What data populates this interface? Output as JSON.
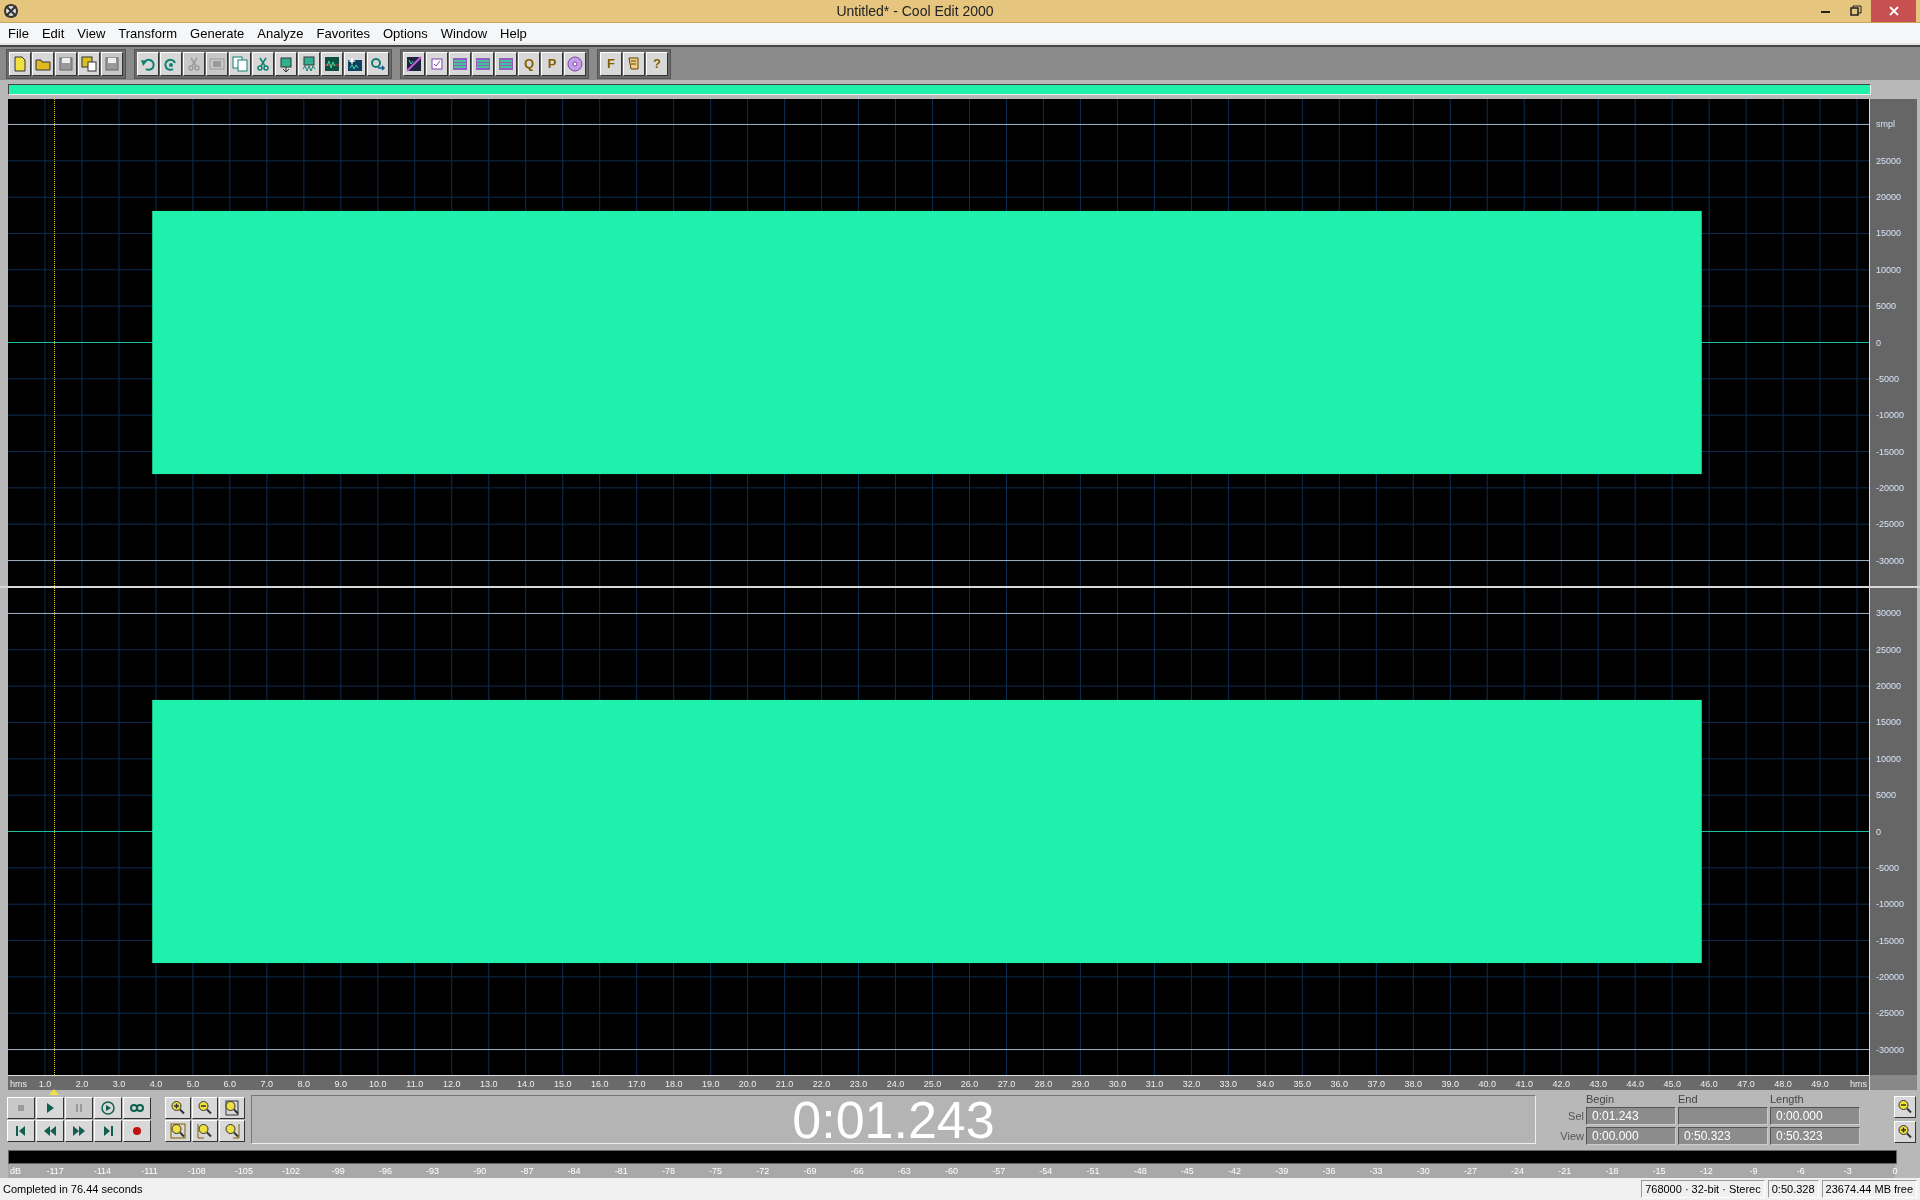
{
  "window": {
    "title": "Untitled* - Cool Edit 2000"
  },
  "menu": [
    "File",
    "Edit",
    "View",
    "Transform",
    "Generate",
    "Analyze",
    "Favorites",
    "Options",
    "Window",
    "Help"
  ],
  "toolbar_groups": [
    [
      {
        "kind": "new-file",
        "disabled": false
      },
      {
        "kind": "folder",
        "disabled": false
      },
      {
        "kind": "disk",
        "disabled": true
      },
      {
        "kind": "disk-copy",
        "disabled": false
      },
      {
        "kind": "disk",
        "disabled": true
      }
    ],
    [
      {
        "kind": "undo",
        "disabled": false
      },
      {
        "kind": "redo",
        "disabled": false
      },
      {
        "kind": "scissors",
        "disabled": true
      },
      {
        "kind": "frame",
        "disabled": true
      },
      {
        "kind": "copy",
        "disabled": false
      },
      {
        "kind": "scissors",
        "disabled": false
      },
      {
        "kind": "paste",
        "disabled": false
      },
      {
        "kind": "paste-wave",
        "disabled": false
      },
      {
        "kind": "wave-window",
        "disabled": false
      },
      {
        "kind": "spark-wave",
        "disabled": false
      },
      {
        "kind": "wave-arrow",
        "disabled": false
      }
    ],
    [
      {
        "kind": "spectral",
        "disabled": false
      },
      {
        "kind": "checkbox",
        "disabled": false
      },
      {
        "kind": "tracks",
        "disabled": false
      },
      {
        "kind": "tracks",
        "disabled": false
      },
      {
        "kind": "tracks",
        "disabled": false
      },
      {
        "kind": "glyph",
        "glyph": "Q",
        "disabled": false
      },
      {
        "kind": "glyph",
        "glyph": "P",
        "disabled": false
      },
      {
        "kind": "cd",
        "disabled": false
      }
    ],
    [
      {
        "kind": "glyph",
        "glyph": "F",
        "disabled": false
      },
      {
        "kind": "scroll",
        "disabled": false
      },
      {
        "kind": "glyph",
        "glyph": "?",
        "disabled": false
      }
    ]
  ],
  "channels": [
    {
      "axis_label": "smpl",
      "ticks": [
        "25000",
        "20000",
        "15000",
        "10000",
        "5000",
        "0",
        "-5000",
        "-10000",
        "-15000",
        "-20000",
        "-25000",
        "-30000"
      ]
    },
    {
      "ticks": [
        "30000",
        "25000",
        "20000",
        "15000",
        "10000",
        "5000",
        "0",
        "-5000",
        "-10000",
        "-15000",
        "-20000",
        "-25000",
        "-30000"
      ]
    }
  ],
  "time_ruler": [
    "hms",
    "1.0",
    "2.0",
    "3.0",
    "4.0",
    "5.0",
    "6.0",
    "7.0",
    "8.0",
    "9.0",
    "10.0",
    "11.0",
    "12.0",
    "13.0",
    "14.0",
    "15.0",
    "16.0",
    "17.0",
    "18.0",
    "19.0",
    "20.0",
    "21.0",
    "22.0",
    "23.0",
    "24.0",
    "25.0",
    "26.0",
    "27.0",
    "28.0",
    "29.0",
    "30.0",
    "31.0",
    "32.0",
    "33.0",
    "34.0",
    "35.0",
    "36.0",
    "37.0",
    "38.0",
    "39.0",
    "40.0",
    "41.0",
    "42.0",
    "43.0",
    "44.0",
    "45.0",
    "46.0",
    "47.0",
    "48.0",
    "49.0",
    "hms"
  ],
  "transport": [
    {
      "kind": "stop",
      "disabled": true
    },
    {
      "kind": "play",
      "disabled": false
    },
    {
      "kind": "pause",
      "disabled": true
    },
    {
      "kind": "play-loop",
      "disabled": false
    },
    {
      "kind": "loop",
      "disabled": false
    },
    {
      "kind": "to-start",
      "disabled": false
    },
    {
      "kind": "rewind",
      "disabled": false
    },
    {
      "kind": "forward",
      "disabled": false
    },
    {
      "kind": "to-end",
      "disabled": false
    },
    {
      "kind": "record",
      "disabled": false
    }
  ],
  "zoom_buttons": [
    {
      "kind": "zoom-in"
    },
    {
      "kind": "zoom-out"
    },
    {
      "kind": "zoom-full"
    },
    {
      "kind": "zoom-selection"
    },
    {
      "kind": "zoom-left"
    },
    {
      "kind": "zoom-right"
    }
  ],
  "time_display": "0:01.243",
  "selection_view": {
    "headers": [
      "Begin",
      "End",
      "Length"
    ],
    "rows": [
      {
        "label": "Sel",
        "begin": "0:01.243",
        "length": "0:00.000"
      },
      {
        "label": "View",
        "begin": "0:00.000",
        "end": "0:50.323",
        "length": "0:50.323"
      }
    ]
  },
  "vertical_zoom": [
    {
      "kind": "zoom-out"
    },
    {
      "kind": "zoom-in"
    }
  ],
  "level_meter": [
    "dB",
    "-117",
    "-114",
    "-111",
    "-108",
    "-105",
    "-102",
    "-99",
    "-96",
    "-93",
    "-90",
    "-87",
    "-84",
    "-81",
    "-78",
    "-75",
    "-72",
    "-69",
    "-66",
    "-63",
    "-60",
    "-57",
    "-54",
    "-51",
    "-48",
    "-45",
    "-42",
    "-39",
    "-36",
    "-33",
    "-30",
    "-27",
    "-24",
    "-21",
    "-18",
    "-15",
    "-12",
    "-9",
    "-6",
    "-3",
    "0"
  ],
  "status_bar": {
    "message": "Completed in 76.44 seconds",
    "format": "768000 · 32-bit · Sterec",
    "duration": "0:50.328",
    "free_space": "23674.44 MB free"
  }
}
